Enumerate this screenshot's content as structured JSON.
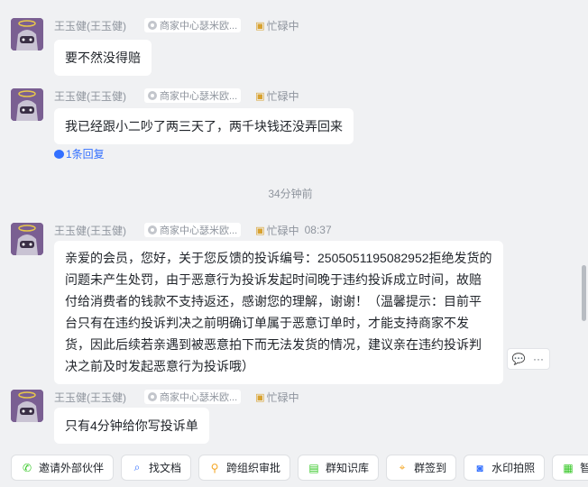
{
  "sender": {
    "name": "王玉健(王玉健)",
    "tag": "商家中心瑟米欧...",
    "status": "忙碌中"
  },
  "messages": [
    {
      "text": "要不然没得赔"
    },
    {
      "text": "我已经跟小二吵了两三天了，两千块钱还没弄回来",
      "reply_label": "1条回复"
    },
    {
      "time": "08:37",
      "text": "亲爱的会员，您好，关于您反馈的投诉编号：2505051195082952拒绝发货的问题未产生处罚，由于恶意行为投诉发起时间晚于违约投诉成立时间，故赔付给消费者的钱款不支持返还，感谢您的理解，谢谢！（温馨提示：目前平台只有在违约投诉判决之前明确订单属于恶意订单时，才能支持商家不发货，因此后续若亲遇到被恶意拍下而无法发货的情况，建议亲在违约投诉判决之前及时发起恶意行为投诉哦）"
    },
    {
      "text": "只有4分钟给你写投诉单"
    }
  ],
  "divider_time": "34分钟前",
  "hover_actions": {
    "reply": "💬",
    "more": "···"
  },
  "toolbar": [
    {
      "label": "邀请外部伙伴",
      "icon": "chat-green-icon"
    },
    {
      "label": "找文档",
      "icon": "doc-search-icon"
    },
    {
      "label": "跨组织审批",
      "icon": "stamp-icon"
    },
    {
      "label": "群知识库",
      "icon": "book-icon"
    },
    {
      "label": "群签到",
      "icon": "location-icon"
    },
    {
      "label": "水印拍照",
      "icon": "camera-icon"
    },
    {
      "label": "智能",
      "icon": "table-icon"
    }
  ],
  "colors": {
    "background": "#f0f1f3",
    "link": "#3370ff",
    "bubble": "#ffffff"
  }
}
